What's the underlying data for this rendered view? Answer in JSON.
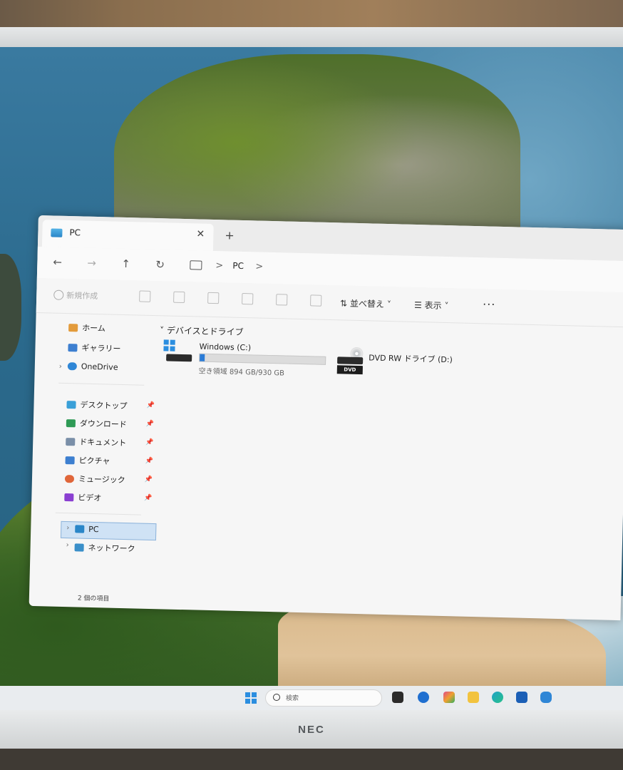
{
  "window": {
    "tab_title": "PC",
    "tab_close": "✕",
    "new_tab": "+"
  },
  "nav": {
    "back": "←",
    "forward": "→",
    "up": "↑",
    "refresh": "↻",
    "crumb_separator": ">",
    "crumb_pc": "PC"
  },
  "toolbar": {
    "new_label": "新規作成",
    "sort_label": "並べ替え",
    "view_label": "表示",
    "more": "···"
  },
  "sidebar": {
    "home": "ホーム",
    "gallery": "ギャラリー",
    "onedrive": "OneDrive",
    "pinned": [
      {
        "label": "デスクトップ",
        "icon": "desktop-icon",
        "color": "#3aa0d8"
      },
      {
        "label": "ダウンロード",
        "icon": "download-icon",
        "color": "#2e9a55"
      },
      {
        "label": "ドキュメント",
        "icon": "documents-icon",
        "color": "#7a8fa8"
      },
      {
        "label": "ピクチャ",
        "icon": "pictures-icon",
        "color": "#3d7fd0"
      },
      {
        "label": "ミュージック",
        "icon": "music-icon",
        "color": "#e0663a"
      },
      {
        "label": "ビデオ",
        "icon": "video-icon",
        "color": "#8a3fd1"
      }
    ],
    "pc": "PC",
    "network": "ネットワーク"
  },
  "main": {
    "group_title": "デバイスとドライブ",
    "drives": [
      {
        "name": "Windows (C:)",
        "free_text": "空き領域 894 GB/930 GB",
        "used_fraction": 0.04,
        "icon": "windows-drive-icon"
      },
      {
        "name": "DVD RW ドライブ (D:)",
        "icon": "dvd-drive-icon",
        "badge": "DVD"
      }
    ]
  },
  "status": {
    "item_count": "2 個の項目"
  },
  "taskbar": {
    "search_placeholder": "検索"
  },
  "monitor": {
    "brand": "NEC"
  },
  "colors": {
    "accent": "#2a7bd6",
    "selection": "#cfe2f5"
  }
}
